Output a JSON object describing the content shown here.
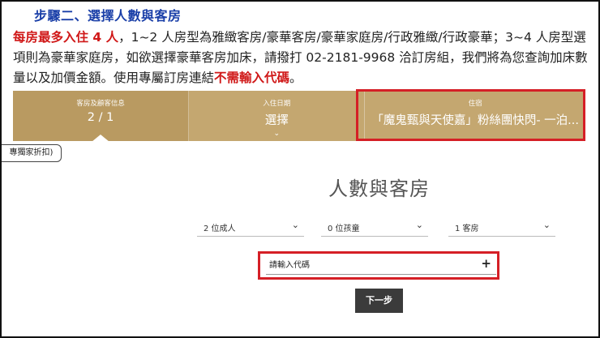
{
  "step_title": "步驟二、選擇人數與客房",
  "intro": {
    "red1": "每房最多入住 4 人",
    "text1": "，1~2 人房型為雅緻客房/豪華客房/豪華家庭房/行政雅緻/行政豪華；3~4 人房型選項則為豪華家庭房，如欲選擇豪華客房加床，請撥打 02-2181-9968 洽訂房組，我們將為您查詢加床數量以及加價金額。使用專屬訂房連結",
    "red2": "不需輸入代碼",
    "text2": "。"
  },
  "banner": {
    "seg1": {
      "small": "客房及顧客信息",
      "big": "2 / 1"
    },
    "seg2": {
      "small": "入住日期",
      "big": "選擇",
      "chevron": "⌄"
    },
    "seg3": {
      "small": "住宿",
      "big": "「魔鬼甄與天使嘉」粉絲團快閃- 一泊..."
    }
  },
  "discount_tag": "專獨家折扣)",
  "section_title": "人數與客房",
  "selects": {
    "adults": "2 位成人",
    "children": "0 位孩童",
    "rooms": "1 客房",
    "caret": "⌄"
  },
  "promo": {
    "placeholder": "請輸入代碼",
    "plus": "+"
  },
  "next_button": "下一步",
  "colors": {
    "banner": "#c4a770",
    "highlight": "#d51f26",
    "title_blue": "#1a3fa8",
    "red_text": "#d01818",
    "button": "#3b3b3b"
  }
}
